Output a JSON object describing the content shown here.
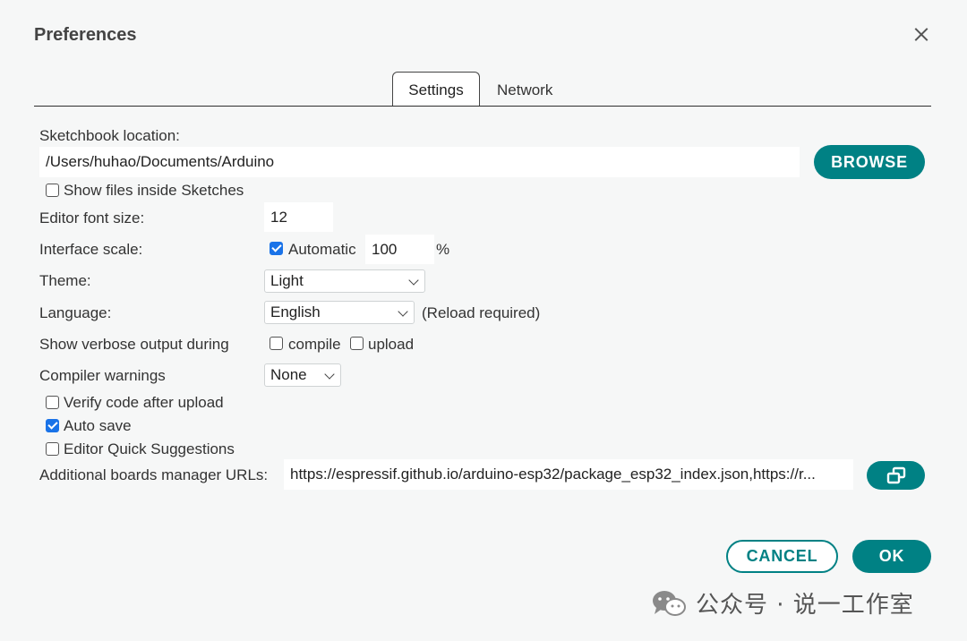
{
  "dialog": {
    "title": "Preferences"
  },
  "tabs": [
    {
      "label": "Settings",
      "active": true
    },
    {
      "label": "Network",
      "active": false
    }
  ],
  "settings": {
    "sketchbook_label": "Sketchbook location:",
    "sketchbook_path": "/Users/huhao/Documents/Arduino",
    "browse_label": "BROWSE",
    "show_files_label": "Show files inside Sketches",
    "show_files_checked": false,
    "font_size_label": "Editor font size:",
    "font_size_value": "12",
    "scale_label": "Interface scale:",
    "scale_auto_label": "Automatic",
    "scale_auto_checked": true,
    "scale_value": "100",
    "scale_unit": "%",
    "theme_label": "Theme:",
    "theme_value": "Light",
    "language_label": "Language:",
    "language_value": "English",
    "language_note": "(Reload required)",
    "verbose_label": "Show verbose output during",
    "verbose_compile_label": "compile",
    "verbose_compile_checked": false,
    "verbose_upload_label": "upload",
    "verbose_upload_checked": false,
    "warnings_label": "Compiler warnings",
    "warnings_value": "None",
    "verify_label": "Verify code after upload",
    "verify_checked": false,
    "autosave_label": "Auto save",
    "autosave_checked": true,
    "suggestions_label": "Editor Quick Suggestions",
    "suggestions_checked": false,
    "boards_urls_label": "Additional boards manager URLs:",
    "boards_urls_value": "https://espressif.github.io/arduino-esp32/package_esp32_index.json,https://r..."
  },
  "footer": {
    "cancel_label": "CANCEL",
    "ok_label": "OK"
  },
  "watermark": {
    "text": "公众号 · 说一工作室"
  },
  "colors": {
    "accent": "#008184",
    "checkbox": "#1a73e8",
    "background": "#f6f7f7"
  },
  "icons": {
    "close": "close-icon",
    "open_window": "open-window-icon",
    "wechat": "wechat-icon"
  }
}
